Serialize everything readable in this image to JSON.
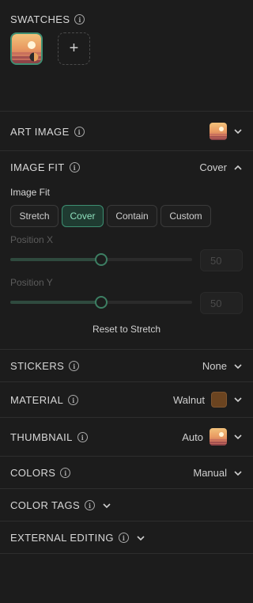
{
  "swatches": {
    "title": "SWATCHES",
    "add_symbol": "+"
  },
  "art_image": {
    "title": "ART IMAGE"
  },
  "image_fit": {
    "title": "IMAGE FIT",
    "value": "Cover",
    "label": "Image Fit",
    "options": [
      "Stretch",
      "Cover",
      "Contain",
      "Custom"
    ],
    "selected": "Cover",
    "position_x": {
      "label": "Position X",
      "value": "50",
      "fraction": 0.5
    },
    "position_y": {
      "label": "Position Y",
      "value": "50",
      "fraction": 0.5
    },
    "reset_label": "Reset to Stretch"
  },
  "stickers": {
    "title": "STICKERS",
    "value": "None"
  },
  "material": {
    "title": "MATERIAL",
    "value": "Walnut"
  },
  "thumbnail": {
    "title": "THUMBNAIL",
    "value": "Auto"
  },
  "colors": {
    "title": "COLORS",
    "value": "Manual"
  },
  "color_tags": {
    "title": "COLOR TAGS"
  },
  "external_editing": {
    "title": "EXTERNAL EDITING"
  },
  "info_glyph": "i",
  "colors_theme": {
    "accent": "#3d8f72",
    "walnut": "#6b4420",
    "background": "#1c1c1c"
  }
}
